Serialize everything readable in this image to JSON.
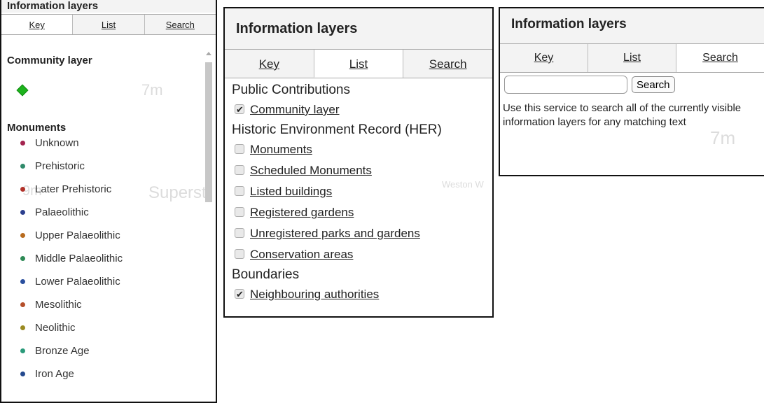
{
  "panel_key": {
    "title": "Information layers",
    "tabs": [
      "Key",
      "List",
      "Search"
    ],
    "community_heading": "Community layer",
    "monuments_heading": "Monuments",
    "legend": [
      {
        "label": "Unknown",
        "color": "#a3234f"
      },
      {
        "label": "Prehistoric",
        "color": "#2f8a6a"
      },
      {
        "label": "Later Prehistoric",
        "color": "#b1322a"
      },
      {
        "label": "Palaeolithic",
        "color": "#2c3f8e"
      },
      {
        "label": "Upper Palaeolithic",
        "color": "#b86b1e"
      },
      {
        "label": "Middle Palaeolithic",
        "color": "#2e8a55"
      },
      {
        "label": "Lower Palaeolithic",
        "color": "#2a4f9e"
      },
      {
        "label": "Mesolithic",
        "color": "#b54f2a"
      },
      {
        "label": "Neolithic",
        "color": "#9a8a21"
      },
      {
        "label": "Bronze Age",
        "color": "#2a9a7a"
      },
      {
        "label": "Iron Age",
        "color": "#24498e"
      }
    ]
  },
  "panel_list": {
    "title": "Information layers",
    "tabs": [
      "Key",
      "List",
      "Search"
    ],
    "groups": [
      {
        "heading": "Public Contributions",
        "items": [
          {
            "label": "Community layer",
            "checked": true
          }
        ]
      },
      {
        "heading": "Historic Environment Record (HER)",
        "items": [
          {
            "label": "Monuments",
            "checked": false
          },
          {
            "label": "Scheduled Monuments",
            "checked": false
          },
          {
            "label": "Listed buildings",
            "checked": false
          },
          {
            "label": "Registered gardens",
            "checked": false
          },
          {
            "label": "Unregistered parks and gardens",
            "checked": false
          },
          {
            "label": "Conservation areas",
            "checked": false
          }
        ]
      },
      {
        "heading": "Boundaries",
        "items": [
          {
            "label": "Neighbouring authorities",
            "checked": true
          }
        ]
      }
    ]
  },
  "panel_search": {
    "title": "Information layers",
    "tabs": [
      "Key",
      "List",
      "Search"
    ],
    "search_value": "",
    "search_button": "Search",
    "help_text": "Use this service to search all of the currently visible information layers for any matching text"
  },
  "map_ghosts": {
    "p1_a": "7m",
    "p1_b": "Superst",
    "p1_c": "9m",
    "p2_a": "Weston W",
    "p3_a": "7m"
  }
}
